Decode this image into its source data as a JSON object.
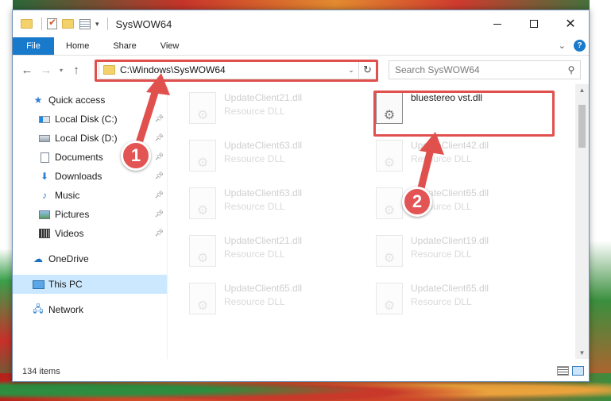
{
  "window": {
    "title": "SysWOW64",
    "min_glyph": "",
    "max_glyph": "",
    "close_glyph": "✕"
  },
  "ribbon": {
    "tabs": [
      "File",
      "Home",
      "Share",
      "View"
    ]
  },
  "address_bar": {
    "path": "C:\\Windows\\SysWOW64"
  },
  "search": {
    "placeholder": "Search SysWOW64"
  },
  "sidebar": {
    "items": [
      {
        "label": "Quick access",
        "icon": "star-icon"
      },
      {
        "label": "Local Disk (C:)",
        "icon": "drive-c-icon",
        "pinned": true
      },
      {
        "label": "Local Disk (D:)",
        "icon": "drive-icon",
        "pinned": true
      },
      {
        "label": "Documents",
        "icon": "documents-icon",
        "pinned": true
      },
      {
        "label": "Downloads",
        "icon": "downloads-icon",
        "pinned": true
      },
      {
        "label": "Music",
        "icon": "music-icon",
        "pinned": true
      },
      {
        "label": "Pictures",
        "icon": "pictures-icon",
        "pinned": true
      },
      {
        "label": "Videos",
        "icon": "videos-icon",
        "pinned": true
      },
      {
        "label": "OneDrive",
        "icon": "onedrive-icon"
      },
      {
        "label": "This PC",
        "icon": "this-pc-icon",
        "selected": true
      },
      {
        "label": "Network",
        "icon": "network-icon"
      }
    ]
  },
  "files": [
    {
      "name": "UpdateClient21.dll",
      "type": "Resource DLL"
    },
    {
      "name": "bluestereo vst.dll",
      "type": ""
    },
    {
      "name": "UpdateClient63.dll",
      "type": "Resource DLL"
    },
    {
      "name": "UpdateClient42.dll",
      "type": "Resource DLL"
    },
    {
      "name": "UpdateClient63.dll",
      "type": "Resource DLL"
    },
    {
      "name": "UpdateClient65.dll",
      "type": "Resource DLL"
    },
    {
      "name": "UpdateClient21.dll",
      "type": "Resource DLL"
    },
    {
      "name": "UpdateClient19.dll",
      "type": "Resource DLL"
    },
    {
      "name": "UpdateClient65.dll",
      "type": "Resource DLL"
    },
    {
      "name": "UpdateClient65.dll",
      "type": "Resource DLL"
    }
  ],
  "status": {
    "item_count": "134 items"
  },
  "annotations": {
    "step1": "1",
    "step2": "2",
    "color": "#e0514e"
  },
  "colors": {
    "file_tab": "#1979ca",
    "selection": "#cce8ff"
  }
}
